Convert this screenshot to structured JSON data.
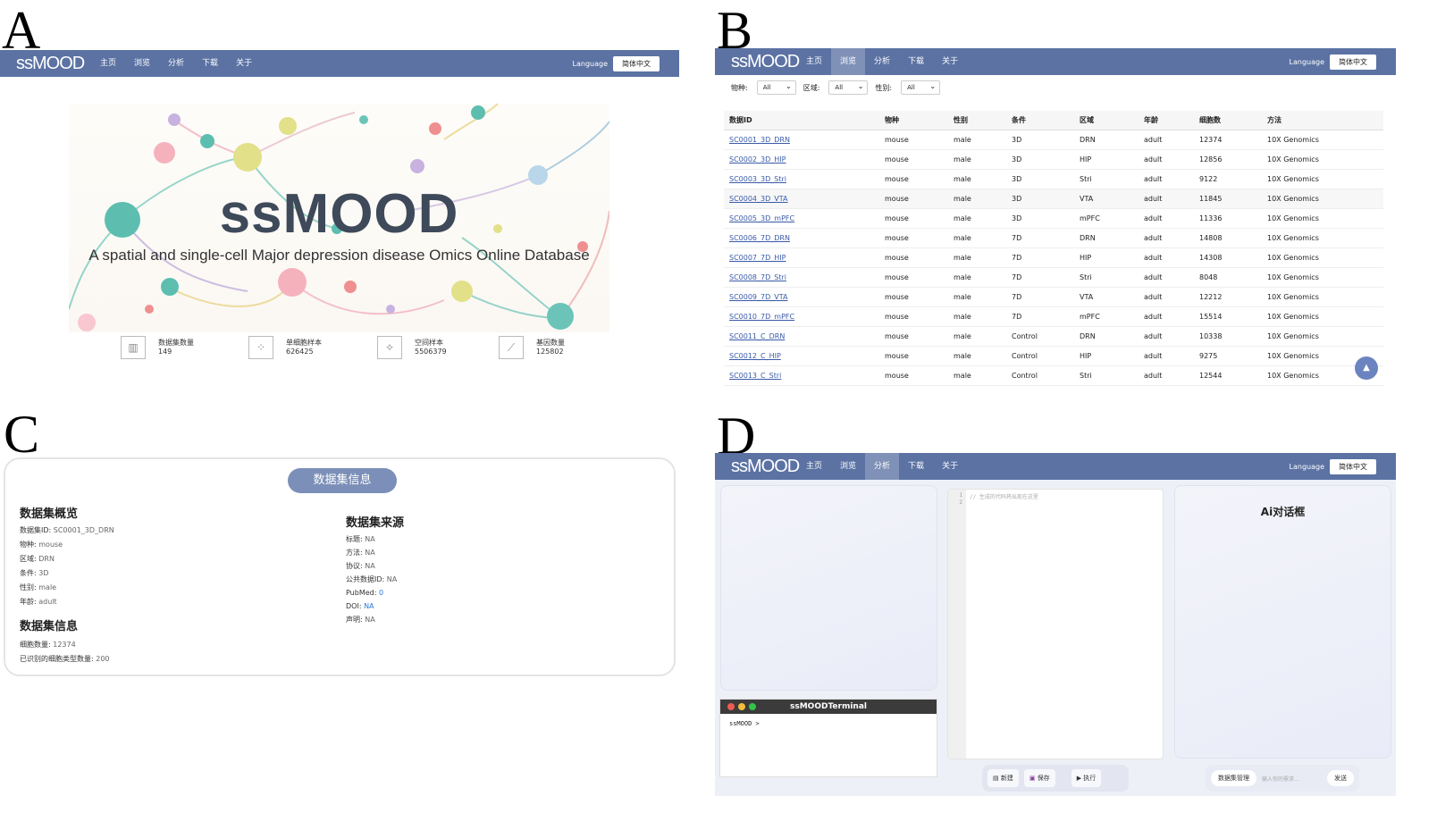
{
  "labels": {
    "a": "A",
    "b": "B",
    "c": "C",
    "d": "D"
  },
  "nav": {
    "logo": "ssMOOD",
    "items": [
      "主页",
      "浏览",
      "分析",
      "下载",
      "关于"
    ],
    "language_label": "Language",
    "language_value": "简体中文"
  },
  "panel_a": {
    "active_item": "主页",
    "banner_title": "ssMOOD",
    "banner_subtitle": "A spatial and single-cell Major depression disease Omics Online Database",
    "stats": [
      {
        "label": "数据集数量",
        "value": "149"
      },
      {
        "label": "单细胞样本",
        "value": "626425"
      },
      {
        "label": "空间样本",
        "value": "5506379"
      },
      {
        "label": "基因数量",
        "value": "125802"
      }
    ]
  },
  "panel_b": {
    "active_item": "浏览",
    "filters": [
      {
        "label": "物种:",
        "value": "All"
      },
      {
        "label": "区域:",
        "value": "All"
      },
      {
        "label": "性别:",
        "value": "All"
      }
    ],
    "columns": [
      "数据ID",
      "物种",
      "性别",
      "条件",
      "区域",
      "年龄",
      "细胞数",
      "方法"
    ],
    "rows": [
      [
        "SC0001_3D_DRN",
        "mouse",
        "male",
        "3D",
        "DRN",
        "adult",
        "12374",
        "10X Genomics"
      ],
      [
        "SC0002_3D_HIP",
        "mouse",
        "male",
        "3D",
        "HIP",
        "adult",
        "12856",
        "10X Genomics"
      ],
      [
        "SC0003_3D_Stri",
        "mouse",
        "male",
        "3D",
        "Stri",
        "adult",
        "9122",
        "10X Genomics"
      ],
      [
        "SC0004_3D_VTA",
        "mouse",
        "male",
        "3D",
        "VTA",
        "adult",
        "11845",
        "10X Genomics"
      ],
      [
        "SC0005_3D_mPFC",
        "mouse",
        "male",
        "3D",
        "mPFC",
        "adult",
        "11336",
        "10X Genomics"
      ],
      [
        "SC0006_7D_DRN",
        "mouse",
        "male",
        "7D",
        "DRN",
        "adult",
        "14808",
        "10X Genomics"
      ],
      [
        "SC0007_7D_HIP",
        "mouse",
        "male",
        "7D",
        "HIP",
        "adult",
        "14308",
        "10X Genomics"
      ],
      [
        "SC0008_7D_Stri",
        "mouse",
        "male",
        "7D",
        "Stri",
        "adult",
        "8048",
        "10X Genomics"
      ],
      [
        "SC0009_7D_VTA",
        "mouse",
        "male",
        "7D",
        "VTA",
        "adult",
        "12212",
        "10X Genomics"
      ],
      [
        "SC0010_7D_mPFC",
        "mouse",
        "male",
        "7D",
        "mPFC",
        "adult",
        "15514",
        "10X Genomics"
      ],
      [
        "SC0011_C_DRN",
        "mouse",
        "male",
        "Control",
        "DRN",
        "adult",
        "10338",
        "10X Genomics"
      ],
      [
        "SC0012_C_HIP",
        "mouse",
        "male",
        "Control",
        "HIP",
        "adult",
        "9275",
        "10X Genomics"
      ],
      [
        "SC0013_C_Stri",
        "mouse",
        "male",
        "Control",
        "Stri",
        "adult",
        "12544",
        "10X Genomics"
      ]
    ],
    "to_top": "▲"
  },
  "panel_c": {
    "header": "数据集信息",
    "overview_title": "数据集概览",
    "overview": [
      {
        "k": "数据集ID: ",
        "v": "SC0001_3D_DRN"
      },
      {
        "k": "物种: ",
        "v": "mouse"
      },
      {
        "k": "区域: ",
        "v": "DRN"
      },
      {
        "k": "条件: ",
        "v": "3D"
      },
      {
        "k": "性别: ",
        "v": "male"
      },
      {
        "k": "年龄: ",
        "v": "adult"
      }
    ],
    "info_title": "数据集信息",
    "info": [
      {
        "k": "细胞数量: ",
        "v": "12374"
      },
      {
        "k": "已识别的细胞类型数量: ",
        "v": "200"
      }
    ],
    "source_title": "数据集来源",
    "source": [
      {
        "k": "标题: ",
        "v": "NA"
      },
      {
        "k": "方法: ",
        "v": "NA"
      },
      {
        "k": "协议: ",
        "v": "NA"
      },
      {
        "k": "公共数据ID: ",
        "v": "NA"
      },
      {
        "k": "PubMed: ",
        "v": "0"
      },
      {
        "k": "DOI: ",
        "v": "NA"
      },
      {
        "k": "声明: ",
        "v": "NA"
      }
    ]
  },
  "panel_d": {
    "active_item": "分析",
    "terminal_title": "ssMOODTerminal",
    "terminal_prompt": "ssMOOD >",
    "editor_lines": [
      "1",
      "2"
    ],
    "editor_comment": "// 生成的代码将出现在这里",
    "toolbar": {
      "new": "新建",
      "save": "保存",
      "run": "执行"
    },
    "ai_title": "Ai对话框",
    "chat": {
      "manage": "数据集管理",
      "placeholder": "输入你的需求...",
      "send": "发送"
    }
  }
}
